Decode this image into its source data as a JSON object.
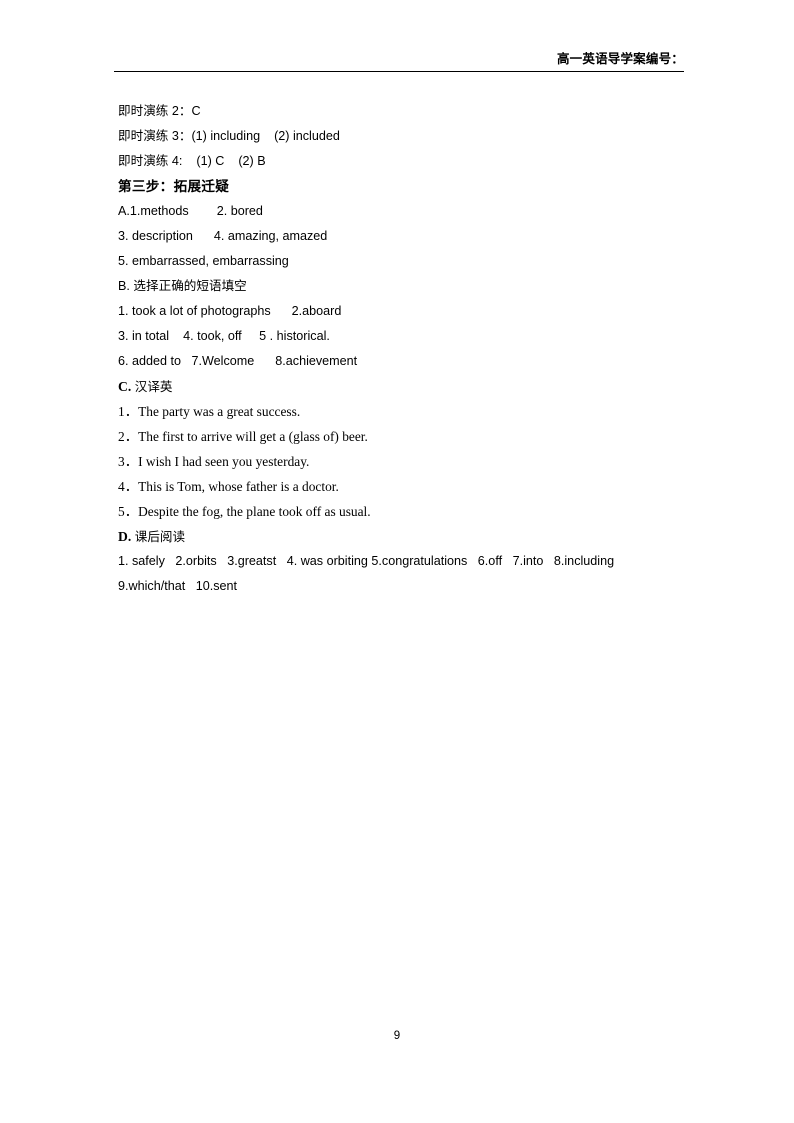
{
  "header": {
    "title": "高一英语导学案编号："
  },
  "body": {
    "lines": [
      {
        "text": "即时演练 2：C"
      },
      {
        "text": "即时演练 3：(1) including    (2) included"
      },
      {
        "text": "即时演练 4:    (1) C    (2) B"
      },
      {
        "text": "第三步：拓展迁疑"
      },
      {
        "text": "A.1.methods        2. bored"
      },
      {
        "text": "3. description      4. amazing, amazed"
      },
      {
        "text": "5. embarrassed, embarrassing"
      }
    ],
    "section_b": {
      "letter": "B.",
      "title": "选择正确的短语填空",
      "lines": [
        {
          "text": "1. took a lot of photographs      2.aboard"
        },
        {
          "text": "3. in total    4. took, off     5 . historical."
        },
        {
          "text": "6. added to   7.Welcome      8.achievement"
        }
      ]
    },
    "section_c": {
      "letter": "C.",
      "title": "汉译英",
      "lines": [
        {
          "text": "1．The party was a great success."
        },
        {
          "text": "2．The first to arrive will get a (glass of) beer."
        },
        {
          "text": "3．I wish I had seen you yesterday."
        },
        {
          "text": "4．This is Tom, whose father is a doctor."
        },
        {
          "text": "5．Despite the fog, the plane took off as usual."
        }
      ]
    },
    "section_d": {
      "letter": "D.",
      "title": "课后阅读",
      "lines": [
        {
          "text": "1. safely   2.orbits   3.greatst   4. was orbiting 5.congratulations   6.off   7.into   8.including"
        },
        {
          "text": "9.which/that   10.sent"
        }
      ]
    }
  },
  "footer": {
    "page_number": "9"
  }
}
